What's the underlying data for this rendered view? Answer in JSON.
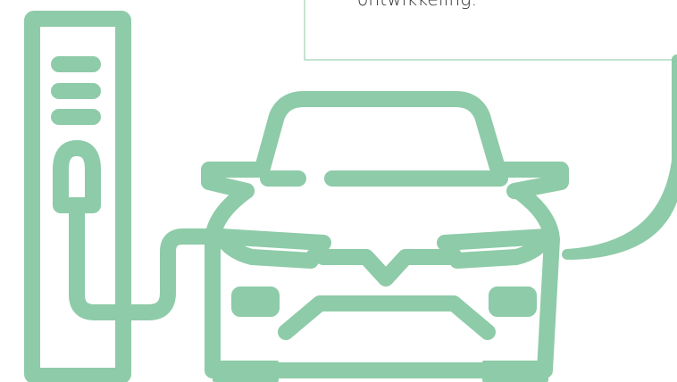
{
  "text_box": {
    "visible_text": "ontwikkeling."
  },
  "illustration": {
    "icon": "ev-charging-station-with-car",
    "stroke_color": "#8ecba8",
    "box_border_color": "#9dd3b4"
  }
}
